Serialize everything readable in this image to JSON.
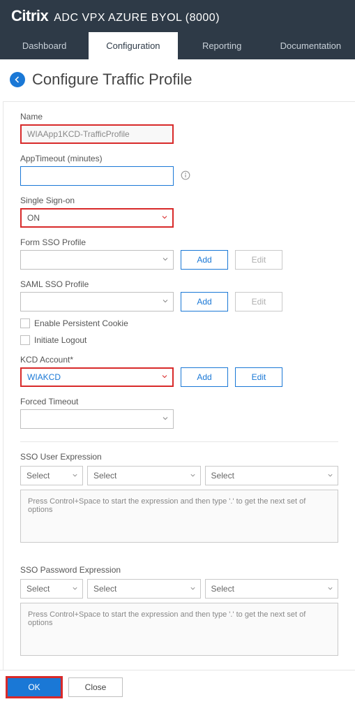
{
  "header": {
    "brand": "Citrix",
    "product": "ADC VPX AZURE BYOL (8000)"
  },
  "tabs": [
    {
      "label": "Dashboard",
      "active": false
    },
    {
      "label": "Configuration",
      "active": true
    },
    {
      "label": "Reporting",
      "active": false
    },
    {
      "label": "Documentation",
      "active": false
    }
  ],
  "page": {
    "title": "Configure Traffic Profile"
  },
  "form": {
    "name_label": "Name",
    "name_value": "WIAApp1KCD-TrafficProfile",
    "app_timeout_label": "AppTimeout (minutes)",
    "app_timeout_value": "",
    "sso_label": "Single Sign-on",
    "sso_value": "ON",
    "form_sso_label": "Form SSO Profile",
    "form_sso_value": "",
    "form_sso_add": "Add",
    "form_sso_edit": "Edit",
    "saml_sso_label": "SAML SSO Profile",
    "saml_sso_value": "",
    "saml_sso_add": "Add",
    "saml_sso_edit": "Edit",
    "persistent_cookie_label": "Enable Persistent Cookie",
    "initiate_logout_label": "Initiate Logout",
    "kcd_label": "KCD Account*",
    "kcd_value": "WIAKCD",
    "kcd_add": "Add",
    "kcd_edit": "Edit",
    "forced_timeout_label": "Forced Timeout",
    "forced_timeout_value": ""
  },
  "sso_user": {
    "label": "SSO User Expression",
    "select_placeholder": "Select",
    "hint": "Press Control+Space to start the expression and then type '.' to get the next set of options"
  },
  "sso_pass": {
    "label": "SSO Password Expression",
    "select_placeholder": "Select",
    "hint": "Press Control+Space to start the expression and then type '.' to get the next set of options"
  },
  "footer": {
    "ok": "OK",
    "close": "Close"
  }
}
